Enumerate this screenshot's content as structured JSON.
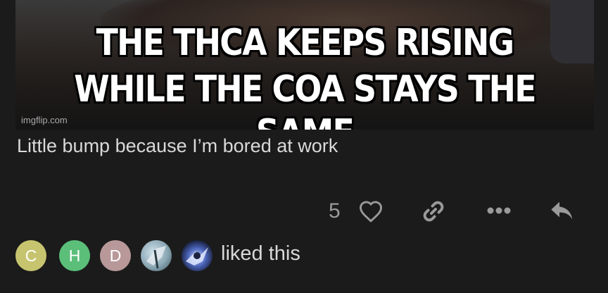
{
  "post": {
    "meme_line1": "THE THCA KEEPS RISING",
    "meme_line2": "WHILE THE COA STAYS THE SAME",
    "watermark": "imgflip.com",
    "caption": "Little bump because I’m bored at work",
    "like_count": "5"
  },
  "icons": {
    "like": "heart-icon",
    "link": "link-icon",
    "more": "more-icon",
    "reply": "reply-icon"
  },
  "likes": {
    "avatars": [
      "C",
      "H",
      "D"
    ],
    "liked_text": "liked this"
  },
  "colors": {
    "background": "#1b1b1b",
    "avatar_c": "#c7c46f",
    "avatar_h": "#5bbf7a",
    "avatar_d": "#b89899"
  }
}
